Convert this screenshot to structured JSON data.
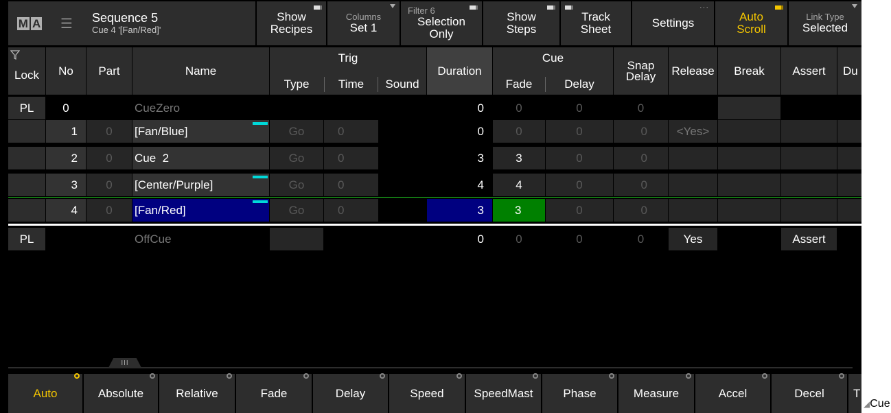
{
  "topbar": {
    "logo_m": "M",
    "logo_a": "A",
    "menu_icon": "list-menu-icon",
    "seq_title": "Sequence 5",
    "seq_subtitle": "Cue 4 '[Fan/Red]'",
    "show_recipes": [
      "Show",
      "Recipes"
    ],
    "columns_label": "Columns",
    "columns_value": "Set 1",
    "filter_label": "Filter 6",
    "selection_only": [
      "Selection",
      "Only"
    ],
    "show_steps": [
      "Show",
      "Steps"
    ],
    "track_sheet": [
      "Track",
      "Sheet"
    ],
    "settings": "Settings",
    "auto_scroll": [
      "Auto",
      "Scroll"
    ],
    "link_type_label": "Link Type",
    "link_type_value": "Selected"
  },
  "headers": {
    "lock": "Lock",
    "no": "No",
    "part": "Part",
    "name": "Name",
    "trig": "Trig",
    "type": "Type",
    "time": "Time",
    "sound": "Sound",
    "duration": "Duration",
    "cue": "Cue",
    "fade": "Fade",
    "delay": "Delay",
    "snap": "Snap",
    "snap2": "Delay",
    "release": "Release",
    "break": "Break",
    "assert": "Assert",
    "dup": "Du",
    "filter_icon": "filter-icon"
  },
  "rows": [
    {
      "lock": "PL",
      "no": "0",
      "part": "",
      "name": "CueZero",
      "type": "",
      "time": "",
      "duration": "0",
      "fade": "0",
      "delay": "0",
      "snap": "0",
      "release": "",
      "assert": ""
    },
    {
      "lock": "",
      "no": "1",
      "part": "0",
      "name": "[Fan/Blue]",
      "type": "Go",
      "time": "0",
      "duration": "0",
      "fade": "0",
      "delay": "0",
      "snap": "0",
      "release": "<Yes>",
      "assert": ""
    },
    {
      "lock": "",
      "no": "2",
      "part": "0",
      "name": "Cue  2",
      "type": "Go",
      "time": "0",
      "duration": "3",
      "fade": "3",
      "delay": "0",
      "snap": "0",
      "release": "",
      "assert": ""
    },
    {
      "lock": "",
      "no": "3",
      "part": "0",
      "name": "[Center/Purple]",
      "type": "Go",
      "time": "0",
      "duration": "4",
      "fade": "4",
      "delay": "0",
      "snap": "0",
      "release": "",
      "assert": ""
    },
    {
      "lock": "",
      "no": "4",
      "part": "0",
      "name": "[Fan/Red]",
      "type": "Go",
      "time": "0",
      "duration": "3",
      "fade": "3",
      "delay": "0",
      "snap": "0",
      "release": "",
      "assert": ""
    },
    {
      "lock": "PL",
      "no": "",
      "part": "",
      "name": "OffCue",
      "type": "",
      "time": "",
      "duration": "0",
      "fade": "0",
      "delay": "0",
      "snap": "0",
      "release": "Yes",
      "assert": "Assert"
    }
  ],
  "bottom": {
    "grip": "III",
    "buttons": [
      "Auto",
      "Absolute",
      "Relative",
      "Fade",
      "Delay",
      "Speed",
      "SpeedMast",
      "Phase",
      "Measure",
      "Accel",
      "Decel",
      "T"
    ]
  },
  "corner_label": "Cue",
  "colors": {
    "accent": "#f5c600",
    "selected": "#000080",
    "active_fade": "#008000",
    "marker": "#00d8d8",
    "panel": "#2d2d2d"
  }
}
